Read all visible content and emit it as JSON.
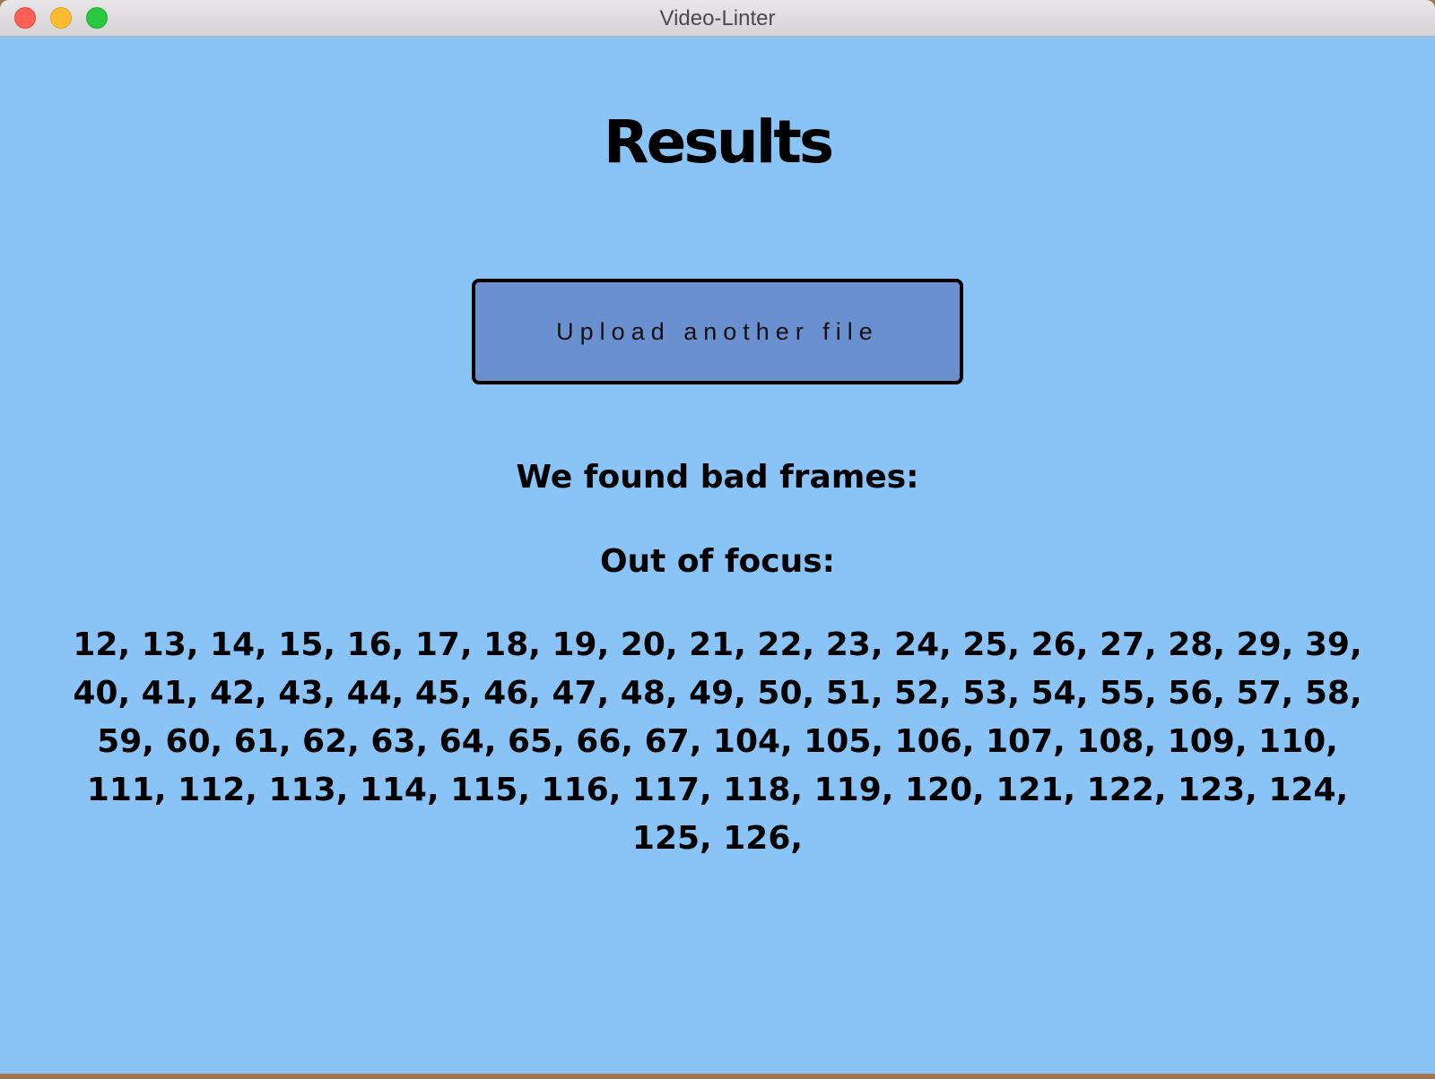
{
  "window": {
    "title": "Video-Linter"
  },
  "page": {
    "heading": "Results",
    "upload_button_label": "Upload another file",
    "found_label": "We found bad frames:",
    "category_label": "Out of focus:",
    "frames_text": "12, 13, 14, 15, 16, 17, 18, 19, 20, 21, 22, 23, 24, 25, 26, 27, 28, 29, 39, 40, 41, 42, 43, 44, 45, 46, 47, 48, 49, 50, 51, 52, 53, 54, 55, 56, 57, 58, 59, 60, 61, 62, 63, 64, 65, 66, 67, 104, 105, 106, 107, 108, 109, 110, 111, 112, 113, 114, 115, 116, 117, 118, 119, 120, 121, 122, 123, 124, 125, 126,"
  },
  "colors": {
    "background": "#8ac4f7",
    "button": "#6a90cf"
  }
}
